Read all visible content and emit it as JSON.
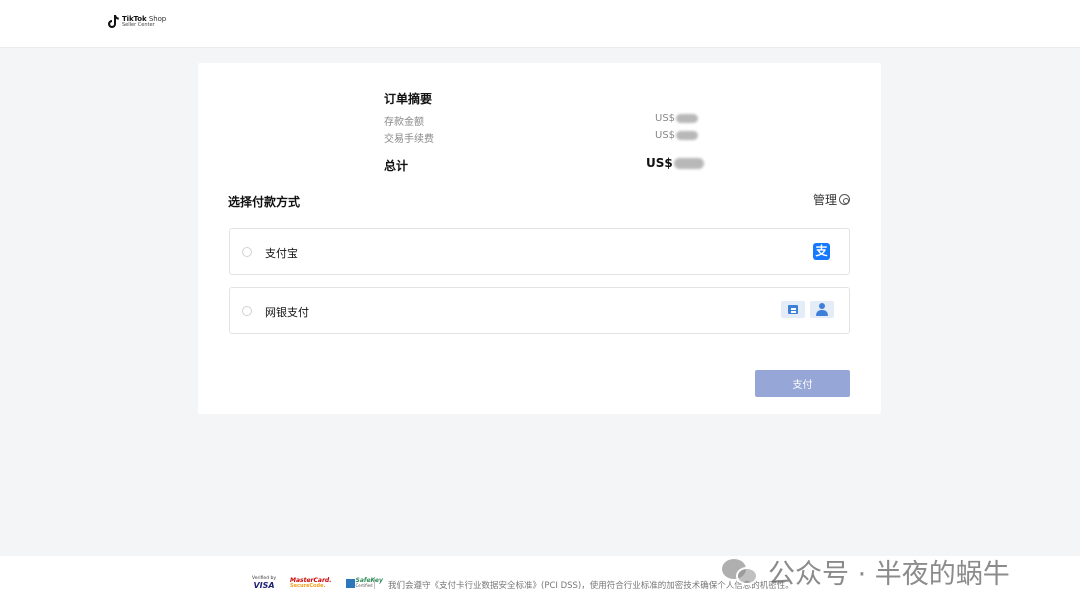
{
  "header": {
    "brand_name": "TikTok",
    "brand_suffix": "Shop",
    "brand_subtitle": "Seller Center"
  },
  "summary": {
    "title": "订单摘要",
    "rows": [
      {
        "label": "存款金额",
        "currency": "US$"
      },
      {
        "label": "交易手续费",
        "currency": "US$"
      }
    ],
    "total_label": "总计",
    "total_currency": "US$"
  },
  "payment": {
    "heading": "选择付款方式",
    "manage_label": "管理",
    "methods": [
      {
        "label": "支付宝",
        "icon": "alipay-icon",
        "icon_glyph": "支"
      },
      {
        "label": "网银支付",
        "icons": [
          "bank-card-icon",
          "user-account-icon"
        ]
      }
    ],
    "pay_button": "支付"
  },
  "footer": {
    "badges": {
      "visa_line1": "Verified by",
      "visa_line2": "VISA",
      "mc_line1": "MasterCard.",
      "mc_line2": "SecureCode.",
      "amex_line1": "SafeKey",
      "amex_line2": "Certified"
    },
    "compliance_text": "我们会遵守《支付卡行业数据安全标准》(PCI DSS)，使用符合行业标准的加密技术确保个人信息的机密性。"
  },
  "watermark": {
    "text": "公众号 · 半夜的蜗牛"
  },
  "colors": {
    "pay_button_bg": "#96a6d6",
    "alipay_blue": "#1677ff",
    "bank_icon_blue": "#3d7fd9",
    "page_bg": "#f4f5f7"
  }
}
